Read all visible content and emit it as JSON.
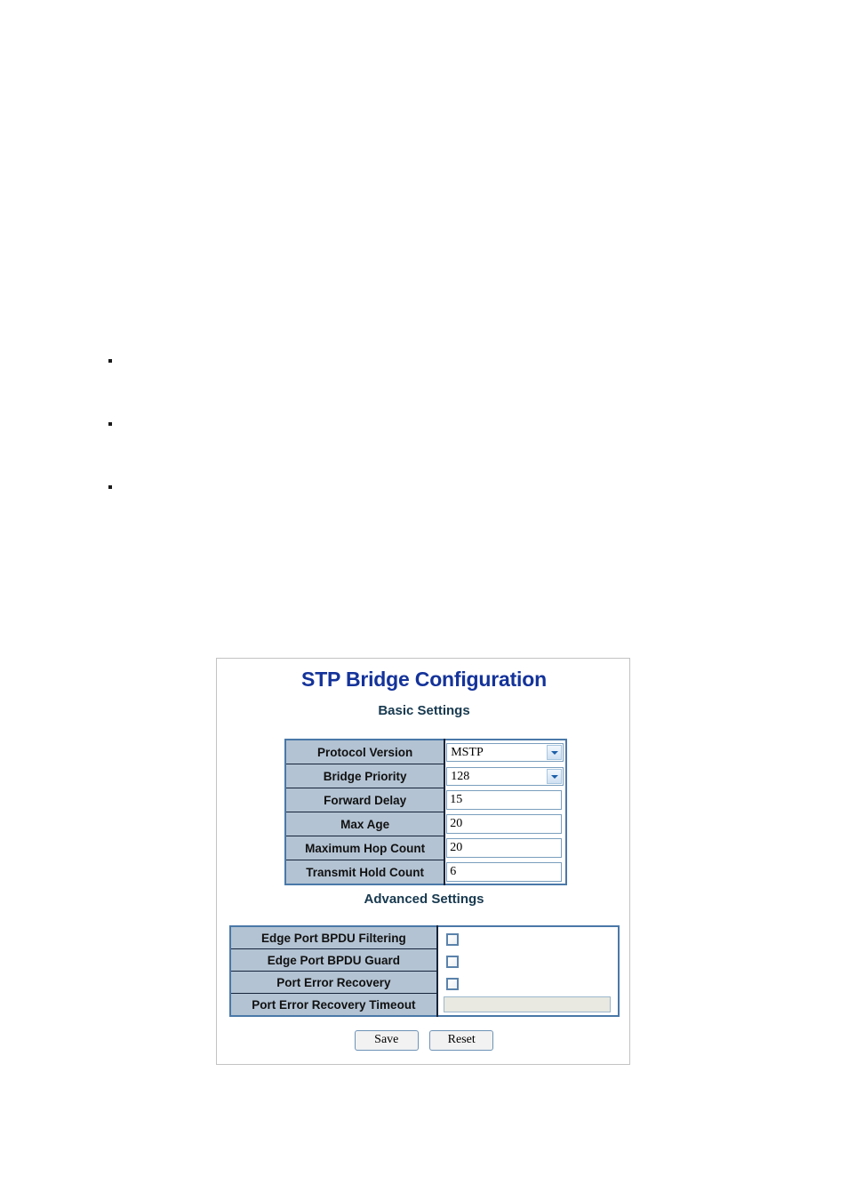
{
  "document": {
    "bullets": [
      {
        "marker": "square-bullet",
        "text": ""
      },
      {
        "marker": "square-bullet",
        "text": ""
      },
      {
        "marker": "square-bullet",
        "text": ""
      }
    ]
  },
  "ui": {
    "title": "STP Bridge Configuration",
    "basic": {
      "heading": "Basic Settings",
      "rows": [
        {
          "label": "Protocol Version",
          "control": "select",
          "value": "MSTP"
        },
        {
          "label": "Bridge Priority",
          "control": "select",
          "value": "128"
        },
        {
          "label": "Forward Delay",
          "control": "text",
          "value": "15"
        },
        {
          "label": "Max Age",
          "control": "text",
          "value": "20"
        },
        {
          "label": "Maximum Hop Count",
          "control": "text",
          "value": "20"
        },
        {
          "label": "Transmit Hold Count",
          "control": "text",
          "value": "6"
        }
      ]
    },
    "advanced": {
      "heading": "Advanced Settings",
      "rows": [
        {
          "label": "Edge Port BPDU Filtering",
          "control": "checkbox",
          "checked": false
        },
        {
          "label": "Edge Port BPDU Guard",
          "control": "checkbox",
          "checked": false
        },
        {
          "label": "Port Error Recovery",
          "control": "checkbox",
          "checked": false
        },
        {
          "label": "Port Error Recovery Timeout",
          "control": "text-disabled",
          "value": ""
        }
      ]
    },
    "buttons": {
      "save": "Save",
      "reset": "Reset"
    },
    "colors": {
      "title": "#14339a",
      "subheading": "#17394f",
      "label_cell_bg": "#b3c3d3",
      "table_border": "#4a78a8",
      "panel_border": "#c3c3c3",
      "disabled_field_bg": "#e9e9e1"
    }
  }
}
